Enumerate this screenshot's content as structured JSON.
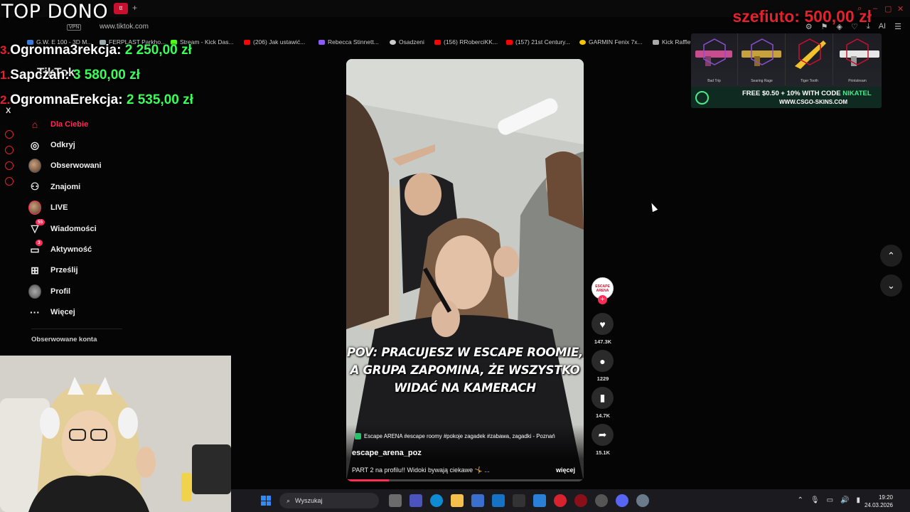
{
  "browser": {
    "url": "www.tiktok.com",
    "vpn_label": "VPN",
    "bookmarks": [
      "G.W. E 100 - 3D M...",
      "FERPLAST Parkho...",
      "Stream - Kick Das...",
      "(206) Jak ustawić...",
      "Rebecca Stinnett...",
      "Osadzeni",
      "(156) RRoberciKK...",
      "(157) 21st Century...",
      "GARMIN Fenix 7x...",
      "Kick Raffle"
    ],
    "ai_label": "AI"
  },
  "overlay": {
    "top_dono_title": "TOP DONO",
    "top_donor": {
      "label": "szefiuto:",
      "amount": "500,00 zł"
    },
    "donors": [
      {
        "rank": "3.",
        "name": "Ogromna3rekcja:",
        "amount": "2 250,00 zł"
      },
      {
        "rank": "1.",
        "name": "Sapczan:",
        "amount": "3 580,00 zł"
      },
      {
        "rank": "2.",
        "name": "OgromnaErekcja:",
        "amount": "2 535,00 zł"
      }
    ],
    "logo_text": "TikTok"
  },
  "sidebar": {
    "items": [
      {
        "label": "Dla Ciebie",
        "icon": "home-icon"
      },
      {
        "label": "Odkryj",
        "icon": "compass-icon"
      },
      {
        "label": "Obserwowani",
        "icon": "avatar-icon"
      },
      {
        "label": "Znajomi",
        "icon": "friends-icon"
      },
      {
        "label": "LIVE",
        "icon": "live-icon"
      },
      {
        "label": "Wiadomości",
        "icon": "messages-icon",
        "badge": "55"
      },
      {
        "label": "Aktywność",
        "icon": "activity-icon",
        "badge": "3"
      },
      {
        "label": "Prześlij",
        "icon": "upload-icon"
      },
      {
        "label": "Profil",
        "icon": "profile-icon"
      },
      {
        "label": "Więcej",
        "icon": "more-icon"
      }
    ],
    "followed_title": "Obserwowane konta"
  },
  "video": {
    "caption_lines": [
      "POV: PRACUJESZ W ESCAPE ROOMIE,",
      "A GRUPA ZAPOMINA, ŻE WSZYSTKO",
      "WIDAĆ NA KAMERACH"
    ],
    "tags": "Escape ARENA #escape roomy #pokoje zagadek #zabawa, zagadki - Poznań",
    "author": "escape_arena_poz",
    "description": "PART 2 na profilu!! Widoki bywają ciekawe 🤸 ...",
    "more_label": "więcej",
    "progress_fraction": 0.18
  },
  "actions": {
    "creator_avatar_text": "ESCAPE ARENA",
    "likes": "147.3K",
    "comments": "1229",
    "saves": "14.7K",
    "shares": "15.1K"
  },
  "ad": {
    "items": [
      "Bad Trip",
      "Searing Rage",
      "Tiger Tooth",
      "Printstream"
    ],
    "line1_prefix": "FREE $0.50 + 10% WITH CODE ",
    "line1_code": "NIKATEL",
    "line2": "WWW.CSGO-SKINS.COM"
  },
  "taskbar": {
    "search_placeholder": "Wyszukaj",
    "time": "19:20",
    "date": "24.03.2026"
  },
  "colors": {
    "tiktok_red": "#fe2c55",
    "donor_green": "#39ff5a",
    "overlay_red": "#e4212e"
  }
}
